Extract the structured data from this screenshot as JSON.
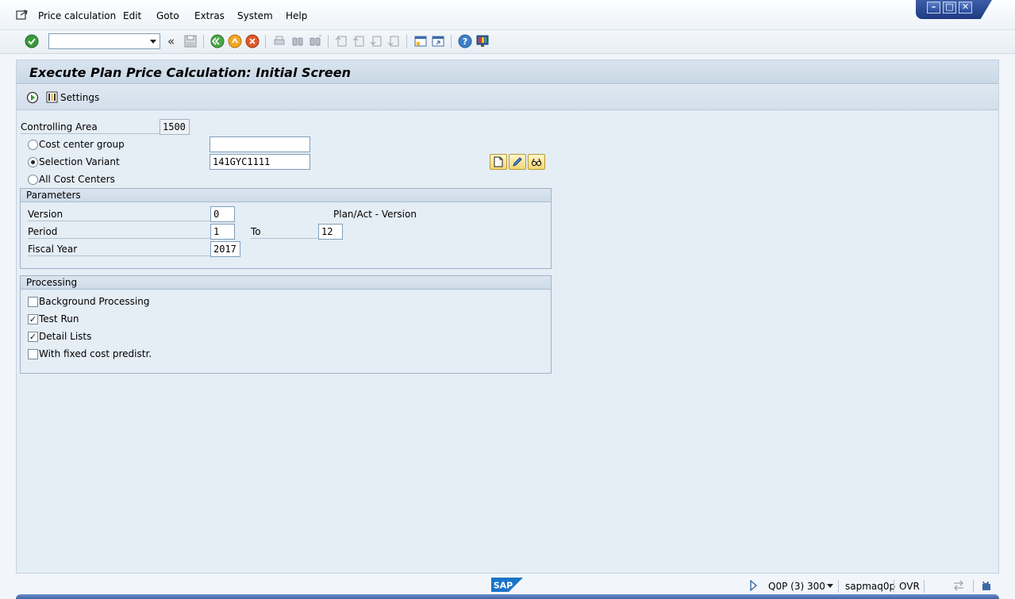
{
  "menu": {
    "items": [
      "Price calculation",
      "Edit",
      "Goto",
      "Extras",
      "System",
      "Help"
    ]
  },
  "toolbar": {
    "command_field_value": "",
    "icons": [
      "enter-icon",
      "back-icon",
      "save-icon",
      "back-green-icon",
      "exit-icon",
      "cancel-icon",
      "print-icon",
      "find-icon",
      "find-next-icon",
      "first-page-icon",
      "previous-page-icon",
      "next-page-icon",
      "last-page-icon",
      "create-session-icon",
      "shortcut-icon",
      "help-icon",
      "customize-layout-icon"
    ]
  },
  "screen": {
    "title": "Execute Plan Price Calculation: Initial Screen",
    "settings_label": "Settings"
  },
  "form": {
    "controlling_area": {
      "label": "Controlling Area",
      "value": "1500"
    },
    "cost_center_group": {
      "label": "Cost center group",
      "value": "",
      "selected": false
    },
    "selection_variant": {
      "label": "Selection Variant",
      "value": "141GYC1111",
      "selected": true
    },
    "all_cost_centers": {
      "label": "All Cost Centers",
      "selected": false
    }
  },
  "parameters": {
    "title": "Parameters",
    "version": {
      "label": "Version",
      "value": "0",
      "description": "Plan/Act - Version"
    },
    "period": {
      "label": "Period",
      "value": "1",
      "to_label": "To",
      "to_value": "12"
    },
    "fiscal_year": {
      "label": "Fiscal Year",
      "value": "2017"
    }
  },
  "processing": {
    "title": "Processing",
    "options": [
      {
        "label": "Background Processing",
        "checked": false
      },
      {
        "label": "Test Run",
        "checked": true
      },
      {
        "label": "Detail Lists",
        "checked": true
      },
      {
        "label": "With fixed cost predistr.",
        "checked": false
      }
    ]
  },
  "statusbar": {
    "system": "Q0P (3) 300",
    "server": "sapmaq0p",
    "mode": "OVR",
    "logo": "SAP"
  },
  "colors": {
    "main_bg": "#e5edf5",
    "title_bar": "#cddbe8",
    "window_controls": "#2a4a98"
  }
}
